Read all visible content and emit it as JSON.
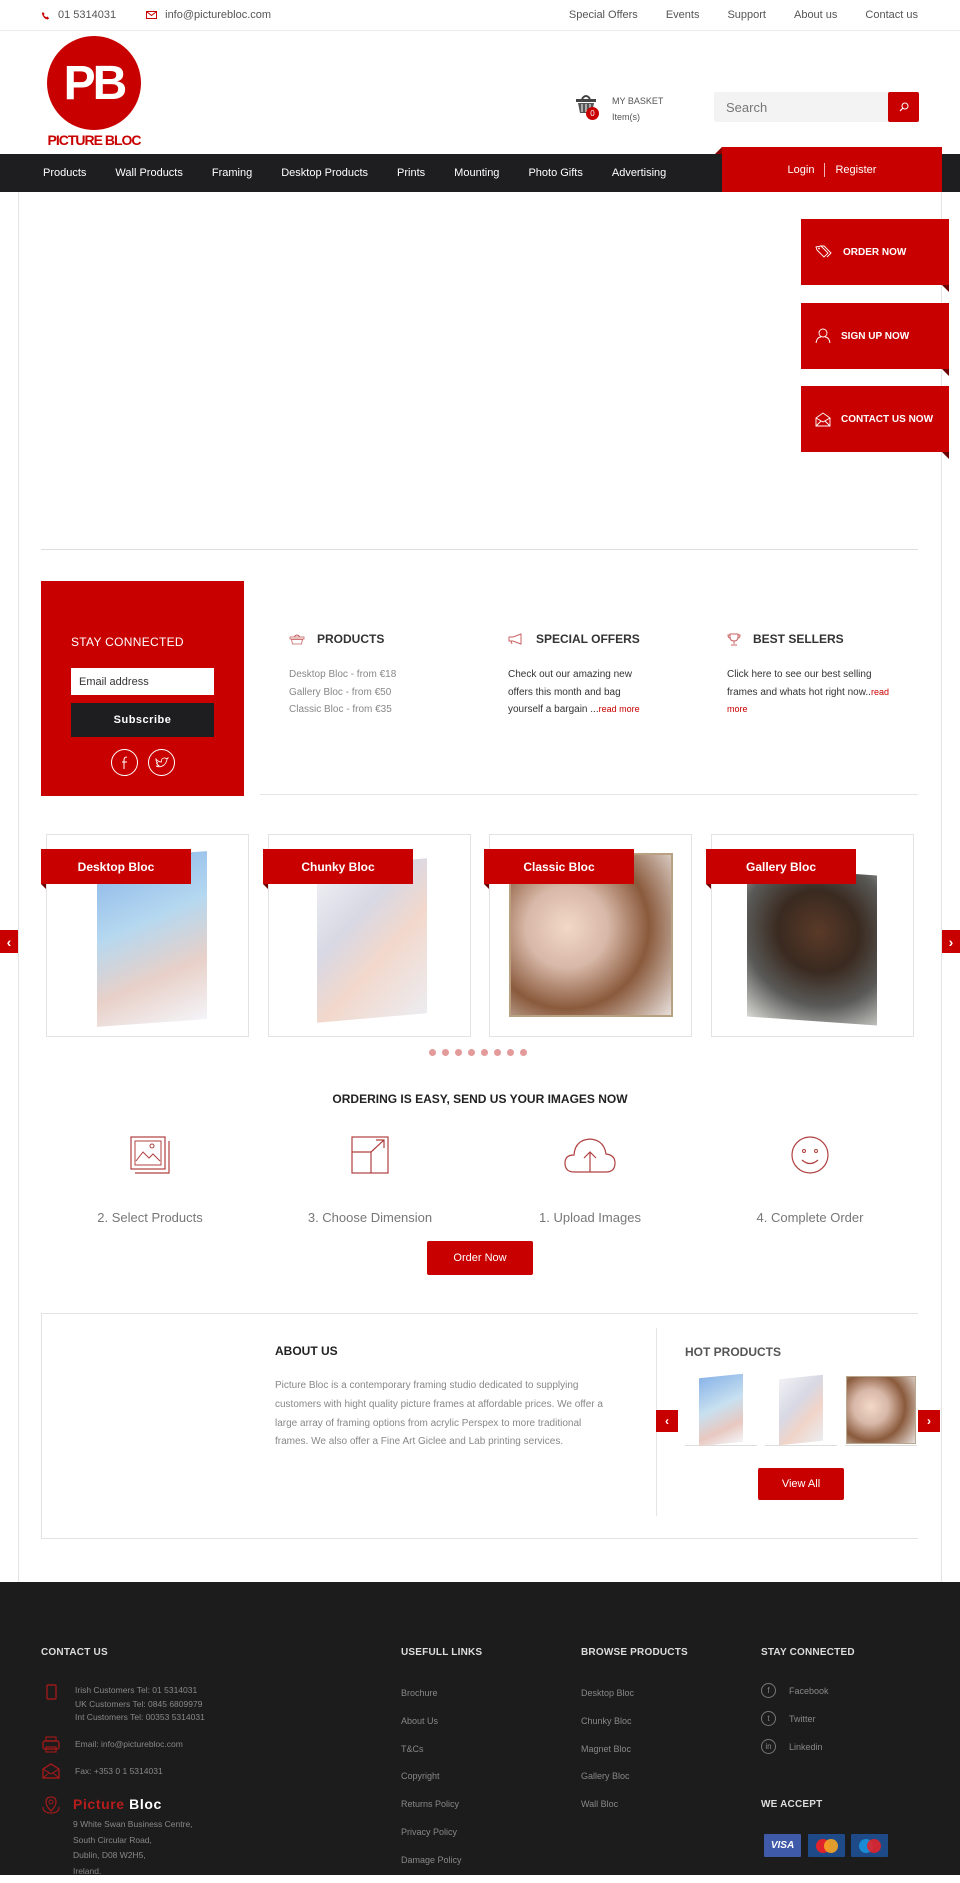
{
  "topbar": {
    "phone": "01 5314031",
    "email": "info@picturebloc.com",
    "links": [
      "Special Offers",
      "Events",
      "Support",
      "About us",
      "Contact us"
    ]
  },
  "header": {
    "logo_initials": "PB",
    "logo_text": "PICTURE BLOC",
    "basket_title": "MY BASKET",
    "basket_items_label": "Item(s)",
    "basket_count": "0",
    "search_placeholder": "Search"
  },
  "nav": {
    "items": [
      "Products",
      "Wall Products",
      "Framing",
      "Desktop Products",
      "Prints",
      "Mounting",
      "Photo Gifts",
      "Advertising"
    ],
    "login": "Login",
    "register": "Register"
  },
  "side_buttons": [
    {
      "label": "ORDER NOW",
      "icon": "tags-icon"
    },
    {
      "label": "SIGN UP NOW",
      "icon": "user-icon"
    },
    {
      "label": "CONTACT US NOW",
      "icon": "envelope-open-icon"
    }
  ],
  "stay_connected": {
    "title": "STAY CONNECTED",
    "email_placeholder": "Email address",
    "subscribe": "Subscribe"
  },
  "features": [
    {
      "title": "PRODUCTS",
      "icon": "basket-icon",
      "lines": [
        "Desktop Bloc - from €18",
        "Gallery Bloc - from €50",
        "Classic Bloc - from €35"
      ]
    },
    {
      "title": "SPECIAL OFFERS",
      "icon": "megaphone-icon",
      "text": "Check out our amazing new offers this month and bag yourself a bargain ...",
      "more": "read more"
    },
    {
      "title": "BEST SELLERS",
      "icon": "trophy-icon",
      "text": "Click here to see our best selling frames and whats hot right now..",
      "more": "read more"
    }
  ],
  "carousel": {
    "items": [
      "Desktop Bloc",
      "Chunky Bloc",
      "Classic Bloc",
      "Gallery Bloc"
    ],
    "dot_count": 8,
    "prev": "‹",
    "next": "›"
  },
  "ordering": {
    "title": "ORDERING IS EASY, SEND US YOUR IMAGES NOW",
    "steps": [
      "2. Select Products",
      "3. Choose Dimension",
      "1. Upload Images",
      "4. Complete Order"
    ],
    "button": "Order Now"
  },
  "about": {
    "title": "ABOUT US",
    "text": "Picture Bloc is a contemporary framing studio dedicated to supplying customers with hight quality picture frames at affordable prices. We offer a large array of framing options from acrylic Perspex to more traditional frames. We also offer a Fine Art Giclee and Lab printing services."
  },
  "hot_products": {
    "title": "HOT PRODUCTS",
    "view_all": "View All"
  },
  "footer": {
    "contact_title": "CONTACT US",
    "phones": [
      "Irish Customers Tel: 01 5314031",
      "UK Customers Tel: 0845 6809979",
      "Int Customers Tel: 00353 5314031"
    ],
    "email": "Email: info@picturebloc.com",
    "fax": "Fax: +353 0 1 5314031",
    "brand_red": "Picture",
    "brand_white": "Bloc",
    "address": [
      "9 White Swan Business Centre,",
      "South Circular Road,",
      "Dublin, D08 W2H5,",
      "Ireland."
    ],
    "links_title": "USEFULL LINKS",
    "links": [
      "Brochure",
      "About Us",
      "T&Cs",
      "Copyright",
      "Returns Policy",
      "Privacy Policy",
      "Damage Policy"
    ],
    "browse_title": "BROWSE PRODUCTS",
    "browse": [
      "Desktop Bloc",
      "Chunky Bloc",
      "Magnet Bloc",
      "Gallery Bloc",
      "Wall Bloc"
    ],
    "social_title": "STAY CONNECTED",
    "social": [
      "Facebook",
      "Twitter",
      "Linkedin"
    ],
    "accept_title": "WE ACCEPT",
    "cards": [
      "VISA",
      "MasterCard",
      "Maestro"
    ]
  },
  "colors": {
    "accent": "#c80000",
    "dark": "#1e1e20"
  }
}
